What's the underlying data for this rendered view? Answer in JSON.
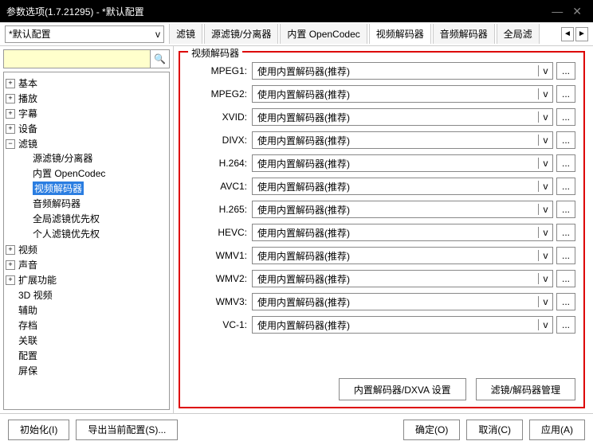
{
  "window": {
    "title": "参数选项(1.7.21295) - *默认配置"
  },
  "profile": {
    "selected": "*默认配置",
    "dd": "v"
  },
  "tabs": [
    {
      "label": "滤镜"
    },
    {
      "label": "源滤镜/分离器"
    },
    {
      "label": "内置 OpenCodec"
    },
    {
      "label": "视频解码器",
      "active": true
    },
    {
      "label": "音频解码器"
    },
    {
      "label": "全局滤"
    }
  ],
  "tabnav": {
    "left": "◄",
    "right": "►"
  },
  "search": {
    "placeholder": "",
    "icon": "🔍"
  },
  "tree": {
    "root": [
      {
        "exp": "+",
        "label": "基本"
      },
      {
        "exp": "+",
        "label": "播放"
      },
      {
        "exp": "+",
        "label": "字幕"
      },
      {
        "exp": "+",
        "label": "设备"
      },
      {
        "exp": "−",
        "label": "滤镜",
        "children": [
          {
            "label": "源滤镜/分离器"
          },
          {
            "label": "内置 OpenCodec"
          },
          {
            "label": "视频解码器",
            "selected": true
          },
          {
            "label": "音频解码器"
          },
          {
            "label": "全局滤镜优先权"
          },
          {
            "label": "个人滤镜优先权"
          }
        ]
      },
      {
        "exp": "+",
        "label": "视频"
      },
      {
        "exp": "+",
        "label": "声音"
      },
      {
        "exp": "+",
        "label": "扩展功能"
      },
      {
        "exp": "",
        "label": "3D 视频"
      },
      {
        "exp": "",
        "label": "辅助"
      },
      {
        "exp": "",
        "label": "存档"
      },
      {
        "exp": "",
        "label": "关联"
      },
      {
        "exp": "",
        "label": "配置"
      },
      {
        "exp": "",
        "label": "屏保"
      }
    ]
  },
  "panel": {
    "title": "视频解码器",
    "default_value": "使用内置解码器(推荐)",
    "dd": "v",
    "more": "...",
    "codecs": [
      {
        "label": "MPEG1:"
      },
      {
        "label": "MPEG2:"
      },
      {
        "label": "XVID:"
      },
      {
        "label": "DIVX:"
      },
      {
        "label": "H.264:"
      },
      {
        "label": "AVC1:"
      },
      {
        "label": "H.265:"
      },
      {
        "label": "HEVC:"
      },
      {
        "label": "WMV1:"
      },
      {
        "label": "WMV2:"
      },
      {
        "label": "WMV3:"
      },
      {
        "label": "VC-1:"
      }
    ],
    "btn1": "内置解码器/DXVA 设置",
    "btn2": "滤镜/解码器管理"
  },
  "footer": {
    "init": "初始化(I)",
    "export": "导出当前配置(S)...",
    "ok": "确定(O)",
    "cancel": "取消(C)",
    "apply": "应用(A)"
  }
}
